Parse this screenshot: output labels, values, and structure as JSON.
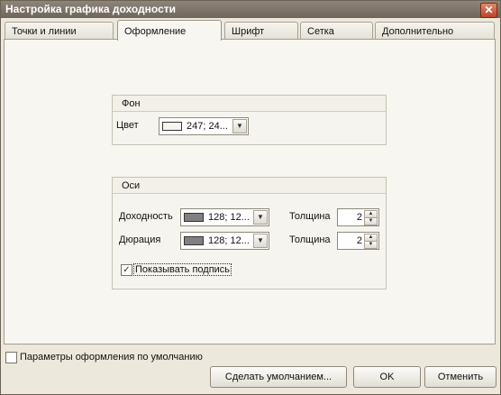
{
  "window": {
    "title": "Настройка графика доходности",
    "close_glyph": "✕"
  },
  "tabs": [
    {
      "label": "Точки и линии",
      "active": false
    },
    {
      "label": "Оформление",
      "active": true
    },
    {
      "label": "Шрифт",
      "active": false
    },
    {
      "label": "Сетка",
      "active": false
    },
    {
      "label": "Дополнительно",
      "active": false
    }
  ],
  "background_group": {
    "title": "Фон",
    "color_label": "Цвет",
    "color_value": "247; 24...",
    "color_swatch": "#f7f5f0"
  },
  "axes_group": {
    "title": "Оси",
    "yield_label": "Доходность",
    "yield_color_value": "128; 12...",
    "yield_swatch": "#808080",
    "yield_thickness_label": "Толщина",
    "yield_thickness_value": "2",
    "duration_label": "Дюрация",
    "duration_color_value": "128; 12...",
    "duration_swatch": "#808080",
    "duration_thickness_label": "Толщина",
    "duration_thickness_value": "2",
    "show_caption_label": "Показывать подпись",
    "show_caption_checked": true
  },
  "footer": {
    "default_params_label": "Параметры оформления по умолчанию",
    "default_params_checked": false,
    "make_default_button": "Сделать умолчанием...",
    "ok_button": "OK",
    "cancel_button": "Отменить"
  },
  "icons": {
    "check": "✓",
    "dropdown": "chevron-down-icon",
    "spin_up": "triangle-up-icon",
    "spin_down": "triangle-down-icon"
  }
}
